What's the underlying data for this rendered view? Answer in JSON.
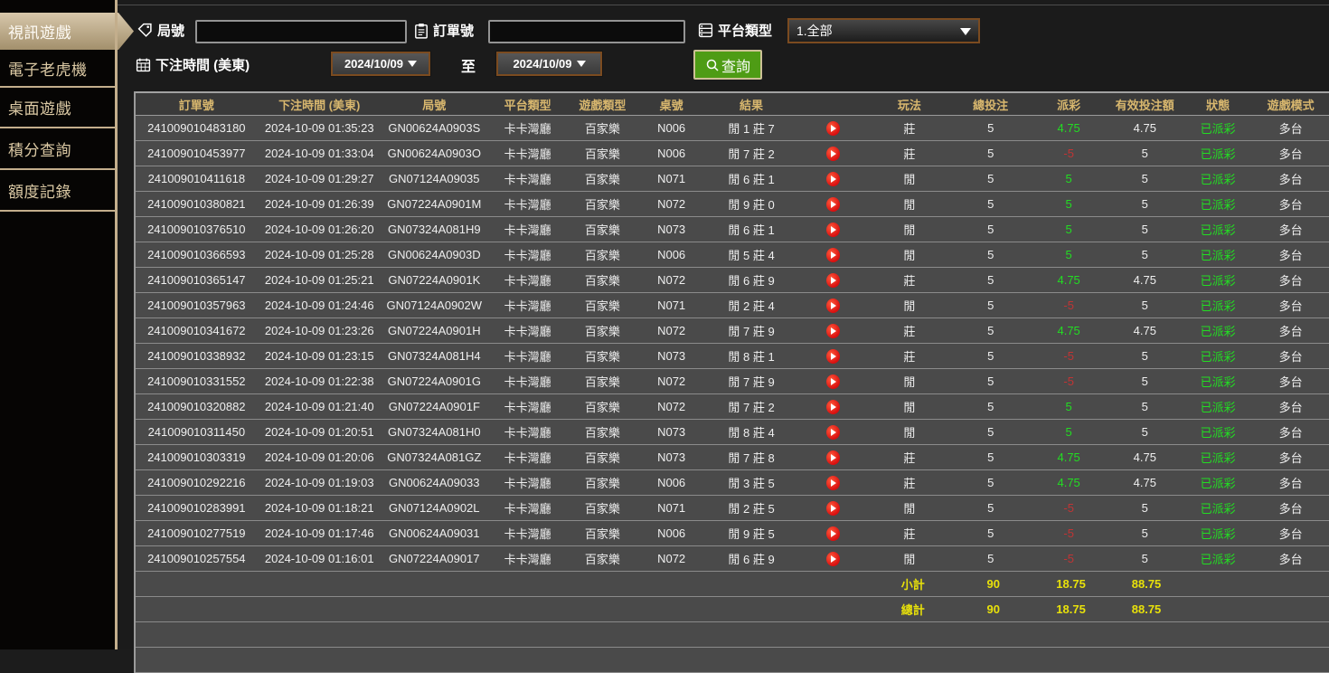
{
  "sidebar": {
    "items": [
      {
        "label": "視訊遊戲",
        "active": true
      },
      {
        "label": "電子老虎機",
        "active": false
      },
      {
        "label": "桌面遊戲",
        "active": false
      },
      {
        "label": "積分查詢",
        "active": false
      },
      {
        "label": "額度記錄",
        "active": false
      }
    ]
  },
  "filters": {
    "round_label": "局號",
    "round_value": "",
    "order_label": "訂單號",
    "order_value": "",
    "platform_label": "平台類型",
    "platform_value": "1.全部",
    "bet_time_label": "下注時間 (美東)",
    "date_from": "2024/10/09",
    "to_label": "至",
    "date_to": "2024/10/09",
    "search_label": "查詢"
  },
  "table": {
    "headers": [
      "訂單號",
      "下注時間 (美東)",
      "局號",
      "平台類型",
      "遊戲類型",
      "桌號",
      "結果",
      "玩法",
      "總投注",
      "派彩",
      "有效投注額",
      "狀態",
      "遊戲模式"
    ],
    "rows": [
      {
        "order_no": "241009010483180",
        "bet_time": "2024-10-09 01:35:23",
        "round_no": "GN00624A0903S",
        "platform": "卡卡灣廳",
        "game_type": "百家樂",
        "table_no": "N006",
        "result": "閒 1 莊 7",
        "wager": "莊",
        "total_bet": "5",
        "payout": "4.75",
        "valid_bet": "4.75",
        "status": "已派彩",
        "mode": "多台"
      },
      {
        "order_no": "241009010453977",
        "bet_time": "2024-10-09 01:33:04",
        "round_no": "GN00624A0903O",
        "platform": "卡卡灣廳",
        "game_type": "百家樂",
        "table_no": "N006",
        "result": "閒 7 莊 2",
        "wager": "莊",
        "total_bet": "5",
        "payout": "-5",
        "valid_bet": "5",
        "status": "已派彩",
        "mode": "多台"
      },
      {
        "order_no": "241009010411618",
        "bet_time": "2024-10-09 01:29:27",
        "round_no": "GN07124A09035",
        "platform": "卡卡灣廳",
        "game_type": "百家樂",
        "table_no": "N071",
        "result": "閒 6 莊 1",
        "wager": "閒",
        "total_bet": "5",
        "payout": "5",
        "valid_bet": "5",
        "status": "已派彩",
        "mode": "多台"
      },
      {
        "order_no": "241009010380821",
        "bet_time": "2024-10-09 01:26:39",
        "round_no": "GN07224A0901M",
        "platform": "卡卡灣廳",
        "game_type": "百家樂",
        "table_no": "N072",
        "result": "閒 9 莊 0",
        "wager": "閒",
        "total_bet": "5",
        "payout": "5",
        "valid_bet": "5",
        "status": "已派彩",
        "mode": "多台"
      },
      {
        "order_no": "241009010376510",
        "bet_time": "2024-10-09 01:26:20",
        "round_no": "GN07324A081H9",
        "platform": "卡卡灣廳",
        "game_type": "百家樂",
        "table_no": "N073",
        "result": "閒 6 莊 1",
        "wager": "閒",
        "total_bet": "5",
        "payout": "5",
        "valid_bet": "5",
        "status": "已派彩",
        "mode": "多台"
      },
      {
        "order_no": "241009010366593",
        "bet_time": "2024-10-09 01:25:28",
        "round_no": "GN00624A0903D",
        "platform": "卡卡灣廳",
        "game_type": "百家樂",
        "table_no": "N006",
        "result": "閒 5 莊 4",
        "wager": "閒",
        "total_bet": "5",
        "payout": "5",
        "valid_bet": "5",
        "status": "已派彩",
        "mode": "多台"
      },
      {
        "order_no": "241009010365147",
        "bet_time": "2024-10-09 01:25:21",
        "round_no": "GN07224A0901K",
        "platform": "卡卡灣廳",
        "game_type": "百家樂",
        "table_no": "N072",
        "result": "閒 6 莊 9",
        "wager": "莊",
        "total_bet": "5",
        "payout": "4.75",
        "valid_bet": "4.75",
        "status": "已派彩",
        "mode": "多台"
      },
      {
        "order_no": "241009010357963",
        "bet_time": "2024-10-09 01:24:46",
        "round_no": "GN07124A0902W",
        "platform": "卡卡灣廳",
        "game_type": "百家樂",
        "table_no": "N071",
        "result": "閒 2 莊 4",
        "wager": "閒",
        "total_bet": "5",
        "payout": "-5",
        "valid_bet": "5",
        "status": "已派彩",
        "mode": "多台"
      },
      {
        "order_no": "241009010341672",
        "bet_time": "2024-10-09 01:23:26",
        "round_no": "GN07224A0901H",
        "platform": "卡卡灣廳",
        "game_type": "百家樂",
        "table_no": "N072",
        "result": "閒 7 莊 9",
        "wager": "莊",
        "total_bet": "5",
        "payout": "4.75",
        "valid_bet": "4.75",
        "status": "已派彩",
        "mode": "多台"
      },
      {
        "order_no": "241009010338932",
        "bet_time": "2024-10-09 01:23:15",
        "round_no": "GN07324A081H4",
        "platform": "卡卡灣廳",
        "game_type": "百家樂",
        "table_no": "N073",
        "result": "閒 8 莊 1",
        "wager": "莊",
        "total_bet": "5",
        "payout": "-5",
        "valid_bet": "5",
        "status": "已派彩",
        "mode": "多台"
      },
      {
        "order_no": "241009010331552",
        "bet_time": "2024-10-09 01:22:38",
        "round_no": "GN07224A0901G",
        "platform": "卡卡灣廳",
        "game_type": "百家樂",
        "table_no": "N072",
        "result": "閒 7 莊 9",
        "wager": "閒",
        "total_bet": "5",
        "payout": "-5",
        "valid_bet": "5",
        "status": "已派彩",
        "mode": "多台"
      },
      {
        "order_no": "241009010320882",
        "bet_time": "2024-10-09 01:21:40",
        "round_no": "GN07224A0901F",
        "platform": "卡卡灣廳",
        "game_type": "百家樂",
        "table_no": "N072",
        "result": "閒 7 莊 2",
        "wager": "閒",
        "total_bet": "5",
        "payout": "5",
        "valid_bet": "5",
        "status": "已派彩",
        "mode": "多台"
      },
      {
        "order_no": "241009010311450",
        "bet_time": "2024-10-09 01:20:51",
        "round_no": "GN07324A081H0",
        "platform": "卡卡灣廳",
        "game_type": "百家樂",
        "table_no": "N073",
        "result": "閒 8 莊 4",
        "wager": "閒",
        "total_bet": "5",
        "payout": "5",
        "valid_bet": "5",
        "status": "已派彩",
        "mode": "多台"
      },
      {
        "order_no": "241009010303319",
        "bet_time": "2024-10-09 01:20:06",
        "round_no": "GN07324A081GZ",
        "platform": "卡卡灣廳",
        "game_type": "百家樂",
        "table_no": "N073",
        "result": "閒 7 莊 8",
        "wager": "莊",
        "total_bet": "5",
        "payout": "4.75",
        "valid_bet": "4.75",
        "status": "已派彩",
        "mode": "多台"
      },
      {
        "order_no": "241009010292216",
        "bet_time": "2024-10-09 01:19:03",
        "round_no": "GN00624A09033",
        "platform": "卡卡灣廳",
        "game_type": "百家樂",
        "table_no": "N006",
        "result": "閒 3 莊 5",
        "wager": "莊",
        "total_bet": "5",
        "payout": "4.75",
        "valid_bet": "4.75",
        "status": "已派彩",
        "mode": "多台"
      },
      {
        "order_no": "241009010283991",
        "bet_time": "2024-10-09 01:18:21",
        "round_no": "GN07124A0902L",
        "platform": "卡卡灣廳",
        "game_type": "百家樂",
        "table_no": "N071",
        "result": "閒 2 莊 5",
        "wager": "閒",
        "total_bet": "5",
        "payout": "-5",
        "valid_bet": "5",
        "status": "已派彩",
        "mode": "多台"
      },
      {
        "order_no": "241009010277519",
        "bet_time": "2024-10-09 01:17:46",
        "round_no": "GN00624A09031",
        "platform": "卡卡灣廳",
        "game_type": "百家樂",
        "table_no": "N006",
        "result": "閒 9 莊 5",
        "wager": "莊",
        "total_bet": "5",
        "payout": "-5",
        "valid_bet": "5",
        "status": "已派彩",
        "mode": "多台"
      },
      {
        "order_no": "241009010257554",
        "bet_time": "2024-10-09 01:16:01",
        "round_no": "GN07224A09017",
        "platform": "卡卡灣廳",
        "game_type": "百家樂",
        "table_no": "N072",
        "result": "閒 6 莊 9",
        "wager": "閒",
        "total_bet": "5",
        "payout": "-5",
        "valid_bet": "5",
        "status": "已派彩",
        "mode": "多台"
      }
    ],
    "subtotal": {
      "label": "小計",
      "total_bet": "90",
      "payout": "18.75",
      "valid_bet": "88.75"
    },
    "grand_total": {
      "label": "總計",
      "total_bet": "90",
      "payout": "18.75",
      "valid_bet": "88.75"
    }
  },
  "colors": {
    "header_text_gold": "#d8b76e",
    "payout_win_green": "#22dd22",
    "payout_loss_red": "#c03434",
    "status_green": "#22dd22",
    "totals_yellow": "#e8e10a",
    "sidebar_tan": "#c3ae8c",
    "search_button_green": "#4e9c15",
    "date_border_brown": "#7b4b20",
    "play_icon_red": "#d90f0f"
  }
}
